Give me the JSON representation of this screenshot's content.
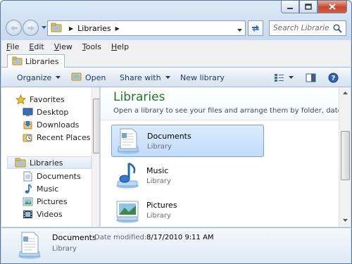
{
  "address": {
    "crumbs": [
      "Libraries"
    ]
  },
  "search": {
    "placeholder": "Search Libraries"
  },
  "menu": {
    "file": {
      "u": "F",
      "rest": "ile"
    },
    "edit": {
      "u": "E",
      "rest": "dit"
    },
    "view": {
      "u": "V",
      "rest": "iew"
    },
    "tools": {
      "u": "T",
      "rest": "ools"
    },
    "help": {
      "u": "H",
      "rest": "elp"
    }
  },
  "tab": {
    "label": "Libraries"
  },
  "toolbar": {
    "organize": "Organize",
    "open": "Open",
    "share_with": "Share with",
    "new_library": "New library"
  },
  "nav": {
    "favorites": {
      "label": "Favorites",
      "items": [
        "Desktop",
        "Downloads",
        "Recent Places"
      ]
    },
    "libraries": {
      "label": "Libraries",
      "items": [
        "Documents",
        "Music",
        "Pictures",
        "Videos"
      ]
    }
  },
  "content": {
    "title": "Libraries",
    "subtitle": "Open a library to see your files and arrange them by folder, date, ...",
    "libraries": [
      {
        "name": "Documents",
        "kind": "Library"
      },
      {
        "name": "Music",
        "kind": "Library"
      },
      {
        "name": "Pictures",
        "kind": "Library"
      }
    ]
  },
  "details": {
    "name": "Documents",
    "date_label": "Date modified:",
    "date_value": "8/17/2010 9:11 AM",
    "kind": "Library"
  }
}
